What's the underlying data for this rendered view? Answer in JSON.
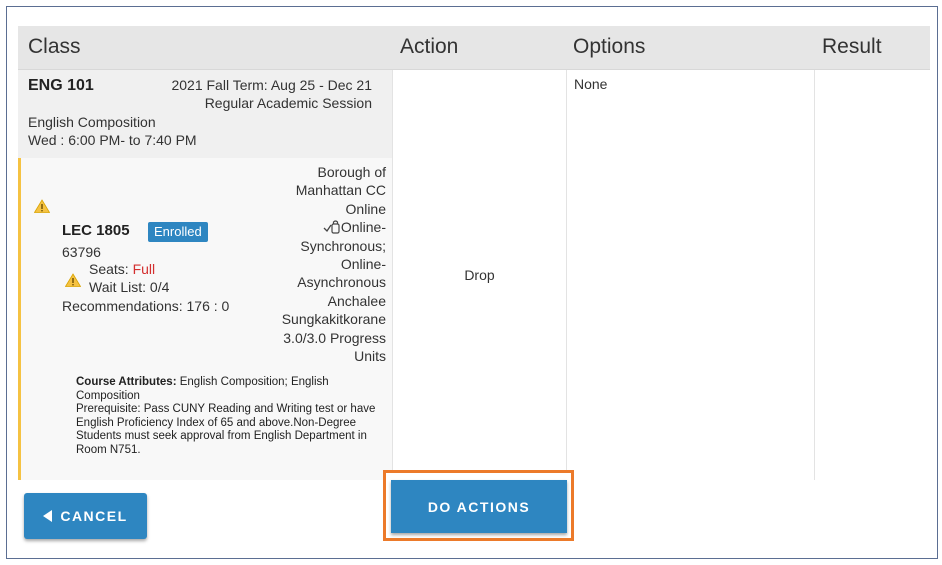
{
  "headers": {
    "class": "Class",
    "action": "Action",
    "options": "Options",
    "result": "Result"
  },
  "class_info": {
    "code": "ENG 101",
    "term_line1": "2021 Fall Term: Aug 25 - Dec 21",
    "term_line2": "Regular Academic Session",
    "title": "English Composition",
    "schedule": "Wed : 6:00 PM- to 7:40 PM"
  },
  "section": {
    "code": "LEC 1805",
    "status_badge": "Enrolled",
    "class_number": "63796",
    "seats_label": "Seats: ",
    "seats_value": "Full",
    "wait_list": "Wait List: 0/4",
    "recommendations": "Recommendations: 176 : 0",
    "campus_line1": "Borough of",
    "campus_line2": "Manhattan CC",
    "location": "Online",
    "mode_line1": "Online-",
    "mode_line2": "Synchronous;",
    "mode_line3": "Online-",
    "mode_line4": "Asynchronous",
    "instructor_line1": "Anchalee",
    "instructor_line2": "Sungkakitkorane",
    "units_line1": "3.0/3.0 Progress",
    "units_line2": "Units",
    "attributes_label": "Course Attributes:",
    "attributes_value": " English Composition; English Composition",
    "prerequisite": "Prerequisite: Pass CUNY Reading and Writing test or have English Proficiency Index of 65 and above.Non-Degree Students must seek approval from English Department in Room N751."
  },
  "options_value": "None",
  "action_value": "Drop",
  "buttons": {
    "cancel": "CANCEL",
    "do_actions": "DO ACTIONS"
  },
  "icons": {
    "warning": "warning-triangle-icon",
    "mode": "online-mode-icon",
    "cancel_arrow": "triangle-left-icon"
  },
  "colors": {
    "primary": "#2e86c1",
    "highlight": "#ec7a2a",
    "warning_border": "#f5c242",
    "seats_full": "#d32f2f"
  }
}
